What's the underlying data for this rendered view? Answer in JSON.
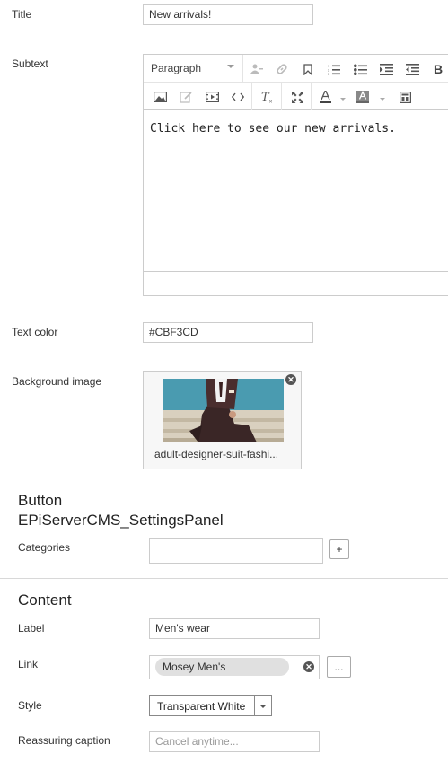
{
  "title_field": {
    "label": "Title",
    "value": "New arrivals!"
  },
  "subtext_field": {
    "label": "Subtext",
    "format_select": "Paragraph",
    "content": "Click here to see our new arrivals.",
    "toolbar_icons": [
      "user-icon",
      "link-icon",
      "bookmark-icon",
      "numbered-list-icon",
      "bullet-list-icon",
      "indent-icon",
      "outdent-icon",
      "bold-icon",
      "image-icon",
      "edit-icon",
      "media-icon",
      "code-icon",
      "clear-format-icon",
      "fullscreen-icon",
      "text-color-icon",
      "background-color-icon",
      "block-icon"
    ]
  },
  "text_color_field": {
    "label": "Text color",
    "value": "#CBF3CD"
  },
  "background_image_field": {
    "label": "Background image",
    "file_name": "adult-designer-suit-fashi..."
  },
  "button_section": {
    "title_line1": "Button",
    "title_line2": "EPiServerCMS_SettingsPanel",
    "categories_label": "Categories",
    "add_label": "+"
  },
  "content_section": {
    "title": "Content",
    "label_label": "Label",
    "label_value": "Men's wear",
    "link_label": "Link",
    "link_value": "Mosey Men's",
    "browse_label": "...",
    "style_label": "Style",
    "style_value": "Transparent White",
    "caption_label": "Reassuring caption",
    "caption_placeholder": "Cancel anytime..."
  }
}
